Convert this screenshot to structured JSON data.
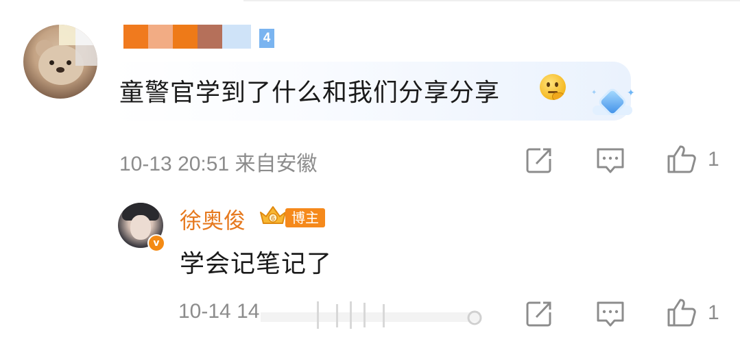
{
  "comment": {
    "name_redacted_colors": [
      "#f07a1e",
      "#f2ac84",
      "#ee7a18",
      "#b5705a",
      "#cfe3f8"
    ],
    "level": "4",
    "text": "童警官学到了什么和我们分享分享",
    "emoji": "thinking-emoji",
    "time": "10-13 20:51",
    "location": "来自安徽",
    "likes": "1"
  },
  "reply": {
    "name": "徐奥俊",
    "badge": "博主",
    "text": "学会记笔记了",
    "time": "10-14 14",
    "likes": "1"
  },
  "colors": {
    "accent_orange": "#e6791e",
    "meta_gray": "#8c8c8c",
    "text": "#1a1a1a",
    "level_blue": "#7ab4f0"
  },
  "icons": {
    "share": "share-icon",
    "comment": "comment-icon",
    "like": "like-icon"
  }
}
